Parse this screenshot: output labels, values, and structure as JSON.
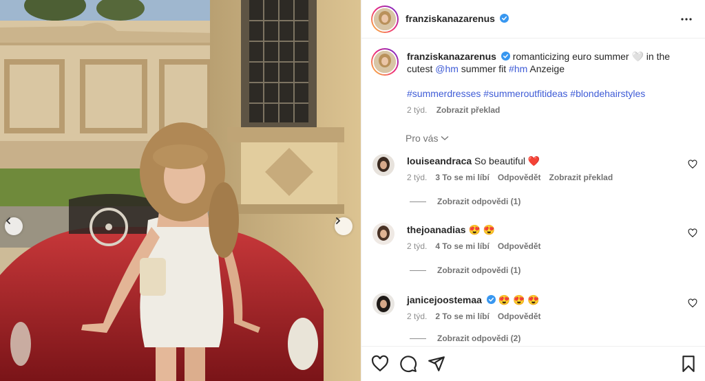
{
  "post": {
    "username": "franziskanazarenus",
    "more_icon": "more-horizontal-icon",
    "prev_icon": "chevron-left-icon",
    "next_icon": "chevron-right-icon",
    "caption": {
      "username": "franziskanazarenus",
      "text1": "romanticizing euro summer ",
      "emoji1": "🤍",
      "text2": " in the cutest ",
      "mention": "@hm",
      "text3": " summer fit ",
      "tag_hm": "#hm",
      "text4": " Anzeige",
      "hashtags": "#summerdresses #summeroutfitideas #blondehairstyles",
      "time": "2 týd.",
      "translate": "Zobrazit překlad"
    },
    "pro_vas": "Pro vás"
  },
  "comments": [
    {
      "username": "louiseandraca",
      "text": "So beautiful",
      "emoji": "❤️",
      "time": "2 týd.",
      "likes": "3 To se mi líbí",
      "reply": "Odpovědět",
      "translate": "Zobrazit překlad",
      "replies": "Zobrazit odpovědi (1)"
    },
    {
      "username": "thejoanadias",
      "text": "",
      "emoji": "😍 😍",
      "time": "2 týd.",
      "likes": "4 To se mi líbí",
      "reply": "Odpovědět",
      "replies": "Zobrazit odpovědi (1)"
    },
    {
      "username": "janicejoostemaa",
      "text": "",
      "emoji": "😍 😍 😍",
      "time": "2 týd.",
      "likes": "2 To se mi líbí",
      "reply": "Odpovědět",
      "replies": "Zobrazit odpovědi (2)"
    }
  ],
  "actions": [
    "heart-icon",
    "comment-icon",
    "share-icon",
    "bookmark-icon"
  ],
  "colors": {
    "link": "#3e5bd6",
    "verified": "#3897f0",
    "car": "#b3262b"
  }
}
